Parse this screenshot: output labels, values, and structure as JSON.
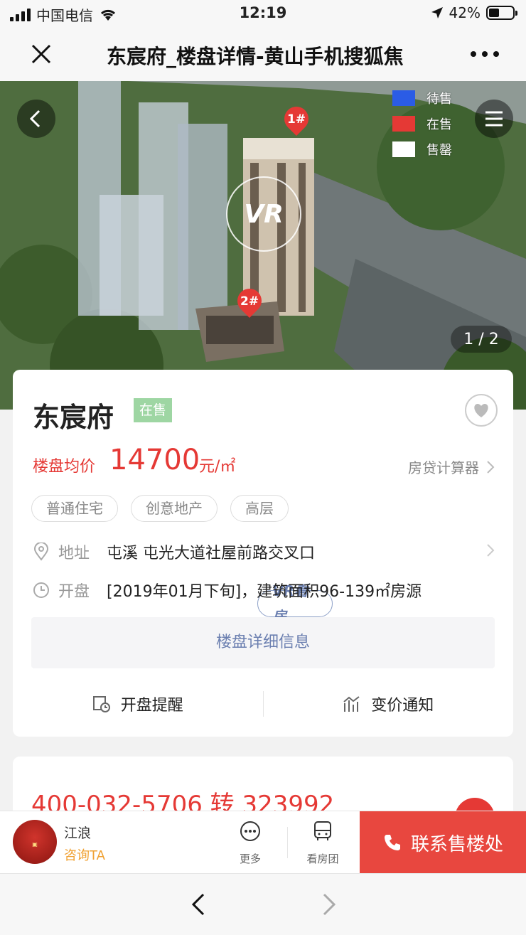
{
  "status_bar": {
    "carrier": "中国电信",
    "time": "12:19",
    "battery": "42%"
  },
  "titlebar": {
    "title": "东宸府_楼盘详情-黄山手机搜狐焦"
  },
  "hero": {
    "legend": [
      {
        "label": "待售",
        "color": "#2b5ce6"
      },
      {
        "label": "在售",
        "color": "#e53935"
      },
      {
        "label": "售罄",
        "color": "#ffffff"
      }
    ],
    "vr_label": "VR",
    "pins": [
      "1#",
      "2#"
    ],
    "counter": "1 / 2"
  },
  "property": {
    "name": "东宸府",
    "status_tag": "在售",
    "price_label": "楼盘均价",
    "price_value": "14700",
    "price_unit": "元/㎡",
    "calculator": "房贷计算器",
    "tags": [
      "VR看房",
      "普通住宅",
      "创意地产",
      "高层"
    ],
    "address_key": "地址",
    "address_value": "屯溪 屯光大道社屋前路交叉口",
    "open_key": "开盘",
    "open_value": "[2019年01月下旬]，建筑面积96-139㎡房源",
    "detail_button": "楼盘详细信息",
    "action_open": "开盘提醒",
    "action_price": "变价通知"
  },
  "contact_card": {
    "phone": "400-032-5706 转 323992"
  },
  "bottom_bar": {
    "agent_name": "江浪",
    "agent_action": "咨询TA",
    "more": "更多",
    "tour": "看房团",
    "contact": "联系售楼处"
  },
  "colors": {
    "accent": "#e53935",
    "link": "#6b7fb0",
    "contact_bg": "#e8473f"
  }
}
